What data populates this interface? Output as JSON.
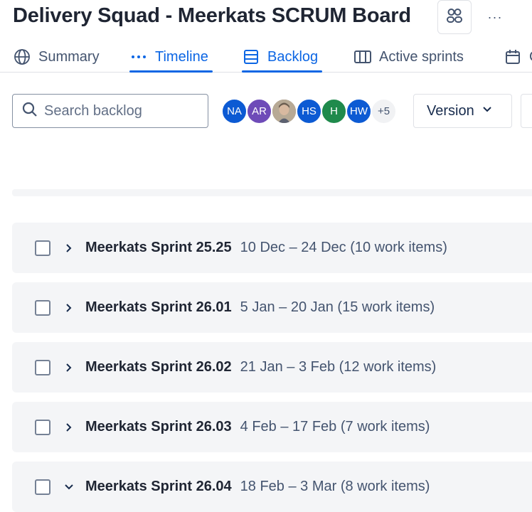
{
  "header": {
    "title": "Delivery Squad - Meerkats SCRUM Board",
    "more_label": "···"
  },
  "tabs": [
    {
      "label": "Summary",
      "icon": "globe-icon",
      "active": false
    },
    {
      "label": "Timeline",
      "icon": "dots-icon",
      "active": true
    },
    {
      "label": "Backlog",
      "icon": "list-icon",
      "active": true
    },
    {
      "label": "Active sprints",
      "icon": "board-icon",
      "active": false
    },
    {
      "label": "C",
      "icon": "calendar-icon",
      "active": false
    }
  ],
  "toolbar": {
    "search_placeholder": "Search backlog",
    "avatars": [
      {
        "initials": "NA",
        "color": "#0c5ad3"
      },
      {
        "initials": "AR",
        "color": "#6e4bb8"
      },
      {
        "initials": "",
        "color": "#8a7a6a",
        "photo": true
      },
      {
        "initials": "HS",
        "color": "#0c5ad3"
      },
      {
        "initials": "H",
        "color": "#1f8a4c"
      },
      {
        "initials": "HW",
        "color": "#0c5ad3"
      }
    ],
    "more_avatars": "+5",
    "version_label": "Version"
  },
  "sprints": [
    {
      "name": "Meerkats Sprint 25.25",
      "meta": "10 Dec – 24 Dec (10 work items)",
      "expanded": false
    },
    {
      "name": "Meerkats Sprint 26.01",
      "meta": "5 Jan – 20 Jan (15 work items)",
      "expanded": false
    },
    {
      "name": "Meerkats Sprint 26.02",
      "meta": "21 Jan – 3 Feb (12 work items)",
      "expanded": false
    },
    {
      "name": "Meerkats Sprint 26.03",
      "meta": "4 Feb – 17 Feb (7 work items)",
      "expanded": false
    },
    {
      "name": "Meerkats Sprint 26.04",
      "meta": "18 Feb – 3 Mar (8 work items)",
      "expanded": true
    }
  ],
  "colors": {
    "accent": "#0c66e4",
    "sprint_bg": "#f4f5f7"
  }
}
